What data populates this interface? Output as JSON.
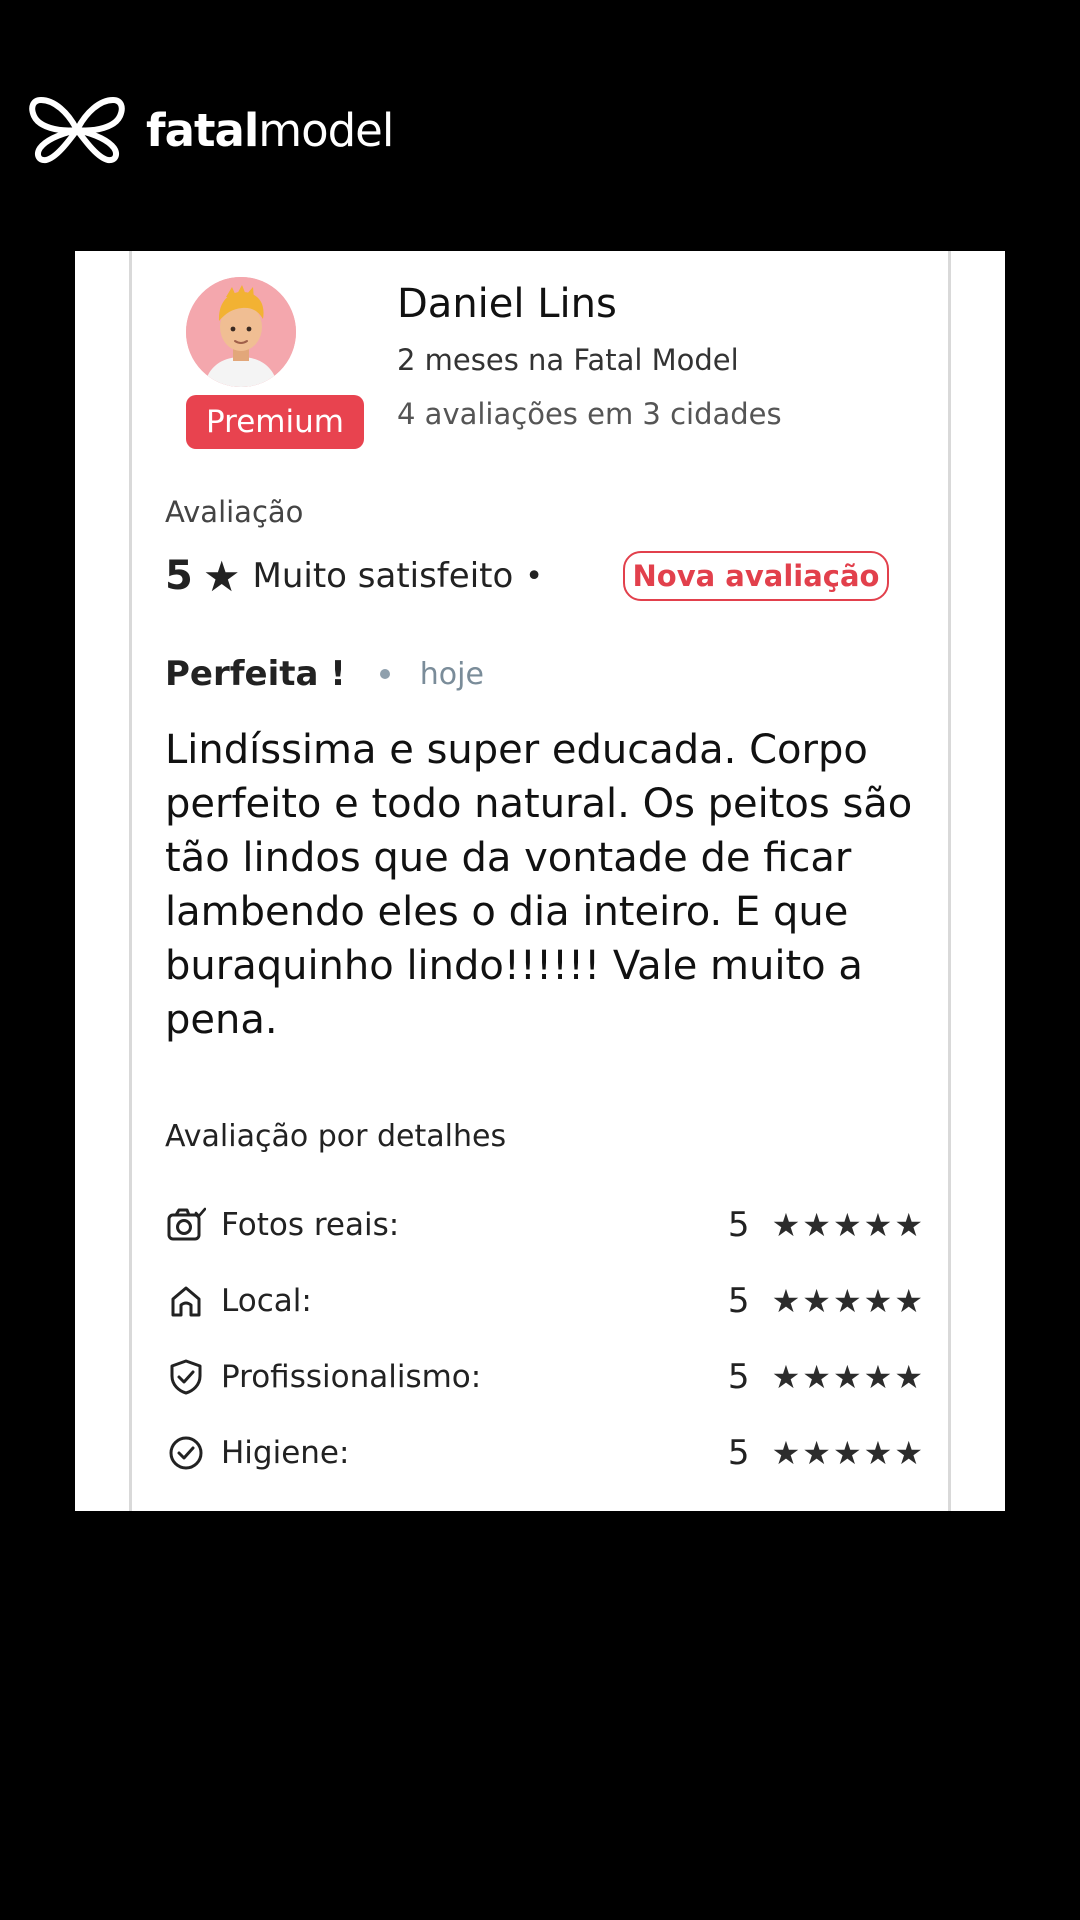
{
  "brand": {
    "logo_icon": "butterfly-icon",
    "name_bold": "fatal",
    "name_regular": "model",
    "accent_color": "#e8434f"
  },
  "reviewer": {
    "name": "Daniel Lins",
    "badge": "Premium",
    "membership": "2 meses na Fatal Model",
    "review_count": "4 avaliações em 3 cidades"
  },
  "rating": {
    "label": "Avaliação",
    "score": "5",
    "star": "★",
    "description": "Muito satisfeito",
    "dot": "•",
    "new_badge": "Nova avaliação"
  },
  "review": {
    "title": "Perfeita !",
    "time": "hoje",
    "body": "Lindíssima e super educada. Corpo perfeito e todo natural. Os peitos são tão lindos que da vontade de ficar lambendo eles o dia inteiro. E que buraquinho lindo!!!!!! Vale muito a pena."
  },
  "details": {
    "label": "Avaliação por detalhes",
    "items": [
      {
        "icon": "camera-icon",
        "label": "Fotos reais:",
        "score": "5",
        "stars": "★★★★★"
      },
      {
        "icon": "home-icon",
        "label": "Local:",
        "score": "5",
        "stars": "★★★★★"
      },
      {
        "icon": "shield-check-icon",
        "label": "Profissionalismo:",
        "score": "5",
        "stars": "★★★★★"
      },
      {
        "icon": "check-circle-icon",
        "label": "Higiene:",
        "score": "5",
        "stars": "★★★★★"
      }
    ]
  }
}
